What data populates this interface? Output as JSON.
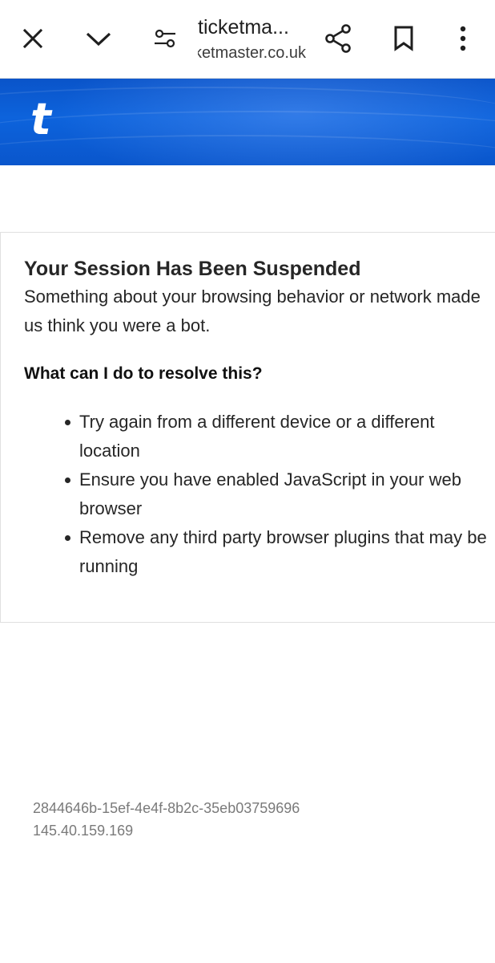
{
  "toolbar": {
    "title": "ticketma...",
    "url": "ticketmaster.co.uk",
    "icons": {
      "close": "close-icon",
      "minimize": "chevron-down-icon",
      "site_settings": "tune-icon",
      "share": "share-icon",
      "bookmark": "bookmark-icon",
      "menu": "more-vert-icon"
    }
  },
  "banner": {
    "logo_text": "t",
    "color": "#0d63dc"
  },
  "card": {
    "heading": "Your Session Has Been Suspended",
    "body": "Something about your browsing behavior or network made us think you were a bot.",
    "resolve_heading": "What can I do to resolve this?",
    "tips": [
      "Try again from a different device or a different location",
      "Ensure you have enabled JavaScript in your web browser",
      "Remove any third party browser plugins that may be running"
    ]
  },
  "reference": {
    "request_id": "2844646b-15ef-4e4f-8b2c-35eb03759696",
    "ip_address": "145.40.159.169"
  }
}
